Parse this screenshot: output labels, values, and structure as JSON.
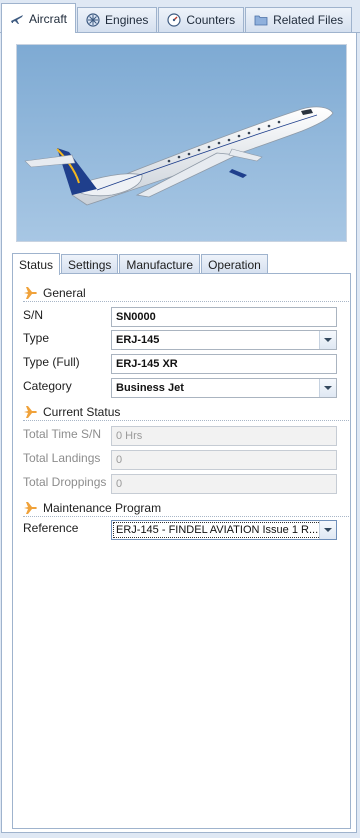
{
  "top_tabs": [
    {
      "label": "Aircraft",
      "icon": "airplane-icon",
      "active": true
    },
    {
      "label": "Engines",
      "icon": "engine-icon",
      "active": false
    },
    {
      "label": "Counters",
      "icon": "gauge-icon",
      "active": false
    },
    {
      "label": "Related Files",
      "icon": "folder-icon",
      "active": false
    }
  ],
  "inner_tabs": [
    {
      "label": "Status",
      "active": true
    },
    {
      "label": "Settings",
      "active": false
    },
    {
      "label": "Manufacture",
      "active": false
    },
    {
      "label": "Operation",
      "active": false
    }
  ],
  "sections": {
    "general": "General",
    "current_status": "Current Status",
    "maintenance_program": "Maintenance Program"
  },
  "fields": {
    "sn": {
      "label": "S/N",
      "value": "SN0000"
    },
    "type": {
      "label": "Type",
      "value": "ERJ-145"
    },
    "type_full": {
      "label": "Type (Full)",
      "value": "ERJ-145 XR"
    },
    "category": {
      "label": "Category",
      "value": "Business Jet"
    },
    "total_time": {
      "label": "Total Time S/N",
      "value": "0 Hrs"
    },
    "total_landings": {
      "label": "Total Landings",
      "value": "0"
    },
    "total_droppings": {
      "label": "Total Droppings",
      "value": "0"
    },
    "reference": {
      "label": "Reference",
      "value": "ERJ-145 - FINDEL AVIATION Issue 1 R..."
    }
  },
  "colors": {
    "section_icon": "#f0a23a",
    "panel_border": "#9fb3cd",
    "background": "#dfe8f4",
    "sky": "#8ab4d8"
  }
}
